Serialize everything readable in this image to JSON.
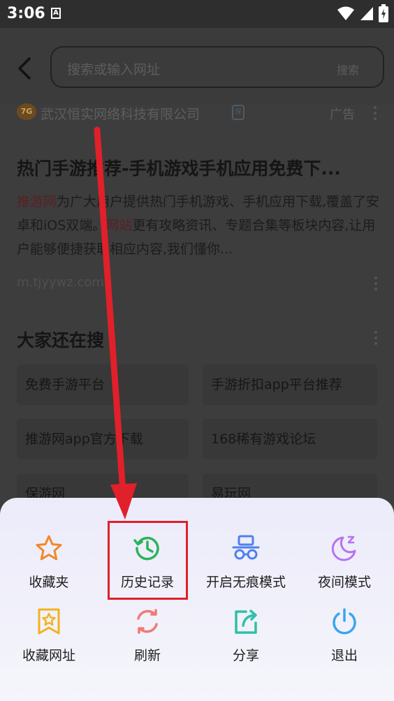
{
  "status_bar": {
    "time": "3:06",
    "notification_badge": "A",
    "icons": [
      "wifi-icon",
      "signal-icon",
      "battery-icon"
    ]
  },
  "search": {
    "placeholder": "搜索或输入网址",
    "button_label": "搜索"
  },
  "ad": {
    "logo_text": "7G",
    "company": "武汉恒实网络科技有限公司",
    "badge": "保",
    "label": "广告"
  },
  "result": {
    "title": "热门手游推荐-手机游戏手机应用免费下...",
    "desc_hl1": "推游网",
    "desc_part1": "为广大用户提供热门手机游戏、手机应用下载,覆盖了安卓和iOS双端。",
    "desc_hl2": "网站",
    "desc_part2": "更有攻略资讯、专题合集等板块内容,让用户能够便捷获取相应内容,我们懂你...",
    "url": "m.tjyywz.com"
  },
  "also_search": {
    "title": "大家还在搜",
    "tags": [
      "免费手游平台",
      "手游折扣app平台推荐",
      "推游网app官方下载",
      "168稀有游戏论坛",
      "保游网",
      "易玩网"
    ]
  },
  "menu": {
    "items": [
      {
        "label": "收藏夹",
        "icon": "star-icon",
        "color": "#f0882a"
      },
      {
        "label": "历史记录",
        "icon": "history-icon",
        "color": "#2bb35b"
      },
      {
        "label": "开启无痕模式",
        "icon": "incognito-icon",
        "color": "#4f7ff0"
      },
      {
        "label": "夜间模式",
        "icon": "moon-icon",
        "color": "#b872f2"
      },
      {
        "label": "收藏网址",
        "icon": "bookmark-star-icon",
        "color": "#f2b21d"
      },
      {
        "label": "刷新",
        "icon": "refresh-icon",
        "color": "#f07a76"
      },
      {
        "label": "分享",
        "icon": "share-icon",
        "color": "#2fc0a8"
      },
      {
        "label": "退出",
        "icon": "power-icon",
        "color": "#3aa6ec"
      }
    ]
  },
  "annotation": {
    "highlight_color": "#e0202a"
  }
}
